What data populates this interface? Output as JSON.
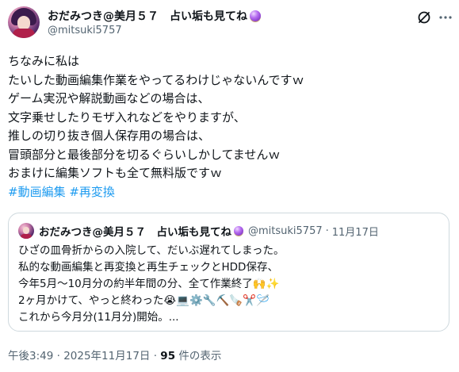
{
  "author": {
    "display_name": "おだみつき@美月５７　占い垢も見てね",
    "handle": "@mitsuki5757"
  },
  "post": {
    "lines": [
      "ちなみに私は",
      "たいした動画編集作業をやってるわけじゃないんですｗ",
      "ゲーム実況や解説動画などの場合は、",
      "文字乗せしたりモザ入れなどをやりますが、",
      "推しの切り抜き個人保存用の場合は、",
      "冒頭部分と最後部分を切るぐらいしかしてませんｗ",
      "おまけに編集ソフトも全て無料版ですｗ"
    ],
    "hashtags": [
      "#動画編集",
      "#再変換"
    ]
  },
  "quoted_post": {
    "display_name": "おだみつき@美月５７　占い垢も見てね",
    "handle": "@mitsuki5757",
    "separator": "·",
    "date": "11月17日",
    "lines": [
      "ひざの皿骨折からの入院して、だいぶ遅れてしまった。",
      "私的な動画編集と再変換と再生チェックとHDD保存、",
      "今年5月～10月分の約半年間の分、全て作業終了🙌✨",
      "2ヶ月かけて、やっと終わった😭💻⚙️🔧⛏️🪚✂️🪡",
      "これから今月分(11月分)開始。..."
    ]
  },
  "footer": {
    "time": "午後3:49",
    "separator1": " · ",
    "date": "2025年11月17日",
    "separator2": " · ",
    "views_count": "95",
    "views_label": " 件の表示"
  },
  "icons": {
    "grok": "grok-icon",
    "more": "more-icon",
    "name_badge": "purple-crystal-ball-icon"
  },
  "colors": {
    "link": "#1d9bf0",
    "secondary_text": "#536471",
    "primary_text": "#0f1419",
    "border": "#cfd9de"
  }
}
